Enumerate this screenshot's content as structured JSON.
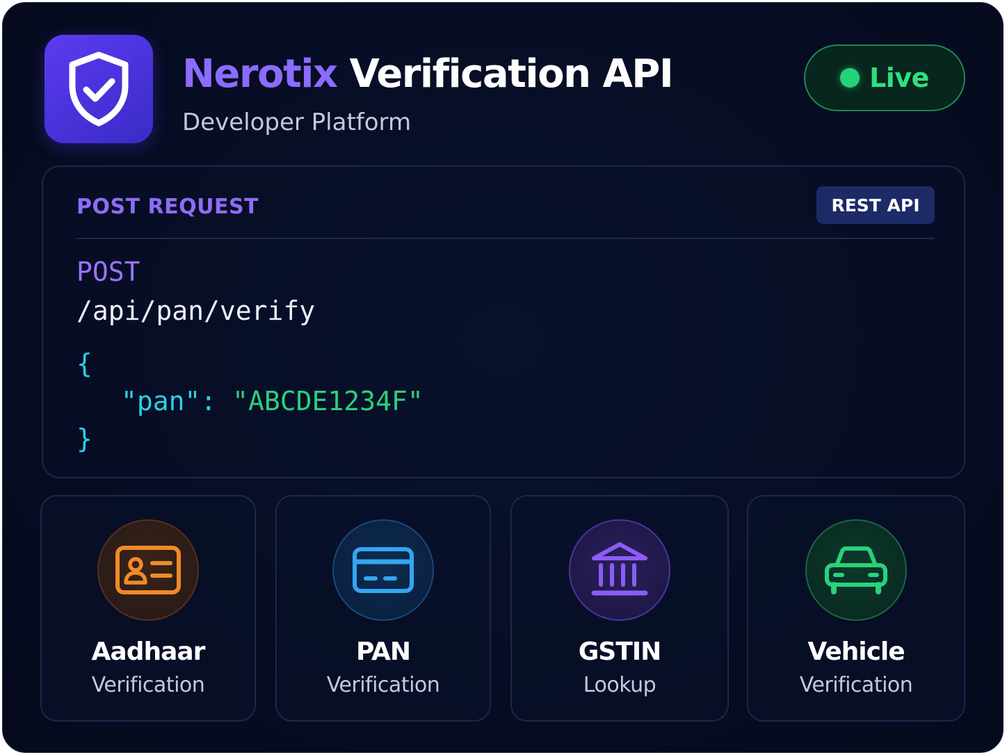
{
  "header": {
    "brand": "Nerotix",
    "title_rest": "Verification API",
    "subtitle": "Developer Platform",
    "logo_icon": "shield-check-icon",
    "status_label": "Live"
  },
  "request": {
    "label": "POST REQUEST",
    "badge": "REST API",
    "method": "POST",
    "path": "/api/pan/verify",
    "open_brace": "{",
    "body_key": "\"pan\"",
    "body_colon": ": ",
    "body_value": "\"ABCDE1234F\"",
    "close_brace": "}"
  },
  "services": [
    {
      "title": "Aadhaar",
      "subtitle": "Verification",
      "icon": "id-card-icon",
      "color": "#f08a2a"
    },
    {
      "title": "PAN",
      "subtitle": "Verification",
      "icon": "credit-card-icon",
      "color": "#33a6f0"
    },
    {
      "title": "GSTIN",
      "subtitle": "Lookup",
      "icon": "bank-building-icon",
      "color": "#8c5cf6"
    },
    {
      "title": "Vehicle",
      "subtitle": "Verification",
      "icon": "car-icon",
      "color": "#27d37a"
    }
  ],
  "colors": {
    "background": "#070d24",
    "accent_purple": "#8b6cff",
    "live_green": "#27d37a",
    "code_cyan": "#2ad1e6",
    "code_green": "#2ccf7c"
  }
}
